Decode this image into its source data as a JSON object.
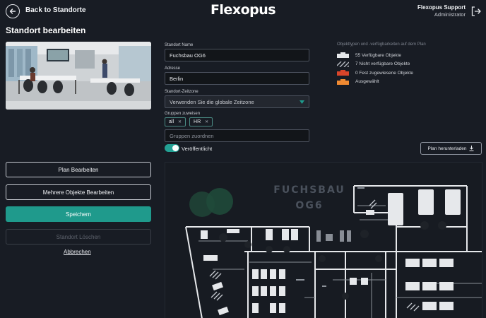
{
  "header": {
    "back_label": "Back to Standorte",
    "logo": "Flexopus",
    "user_name": "Flexopus Support",
    "user_role": "Administrator"
  },
  "page": {
    "title": "Standort bearbeiten"
  },
  "form": {
    "name_label": "Standort Name",
    "name_value": "Fuchsbau OG6",
    "address_label": "Adresse",
    "address_value": "Berlin",
    "timezone_label": "Standort-Zeitzone",
    "timezone_value": "Verwenden Sie die globale Zeitzone",
    "groups_label": "Gruppen zuweisen",
    "group_chips": [
      "all",
      "HR"
    ],
    "groups_placeholder": "Gruppen zuordnen",
    "published_label": "Veröffentlicht",
    "published": true
  },
  "legend": {
    "title": "Objekttypen und -verfügbarkeiten auf dem Plan",
    "items": [
      {
        "label": "55 Verfügbare Objekte",
        "color": "#e6e8eb"
      },
      {
        "label": "7 Nicht verfügbare Objekte",
        "color": "#9a9ea6"
      },
      {
        "label": "0 Fest zugewiesene Objekte",
        "color": "#d9452a"
      },
      {
        "label": "Ausgewählt",
        "color": "#f08a32"
      }
    ]
  },
  "actions": {
    "download_plan": "Plan herunterladen",
    "edit_plan": "Plan Bearbeiten",
    "edit_multiple": "Mehrere Objekte Bearbeiten",
    "save": "Speichern",
    "delete": "Standort Löschen",
    "cancel": "Abbrechen"
  },
  "plan": {
    "title": "FUCHSBAU OG6"
  },
  "colors": {
    "accent": "#1f9a8c",
    "background": "#181c24"
  },
  "icons": [
    "back-arrow-icon",
    "logout-icon",
    "chevron-down-icon",
    "download-icon",
    "close-icon"
  ]
}
